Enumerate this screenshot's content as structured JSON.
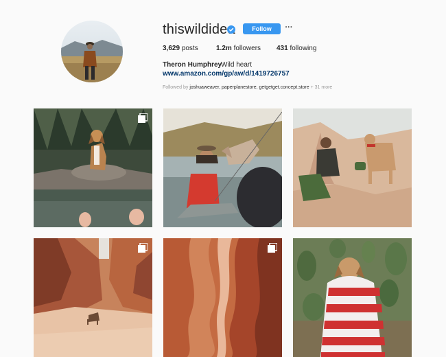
{
  "profile": {
    "username": "thiswildidea",
    "verified_icon": "verified-badge-icon",
    "follow_label": "Follow",
    "more_label": "···",
    "posts_count": "3,629",
    "posts_label": "posts",
    "followers_count": "1.2m",
    "followers_label": "followers",
    "following_count": "431",
    "following_label": "following",
    "full_name": "Theron Humphrey",
    "bio": "Wild heart",
    "link": "www.amazon.com/gp/aw/d/1419726757",
    "followed_by_prefix": "Followed by",
    "followed_by_names": "joshuaweaver, paperplanestore, getgetget.concept.store",
    "followed_by_more": "+ 31 more"
  },
  "colors": {
    "accent": "#3897f0",
    "link": "#003569",
    "background": "#fafafa"
  },
  "posts": [
    {
      "subject": "dog on rocks by forest pool",
      "multi": true
    },
    {
      "subject": "man fishing with dog",
      "multi": false
    },
    {
      "subject": "man and dog on rocks",
      "multi": false
    },
    {
      "subject": "slot canyon with dog",
      "multi": true
    },
    {
      "subject": "red sandstone canyon",
      "multi": true
    },
    {
      "subject": "dog in striped blanket among cacti",
      "multi": false
    }
  ]
}
